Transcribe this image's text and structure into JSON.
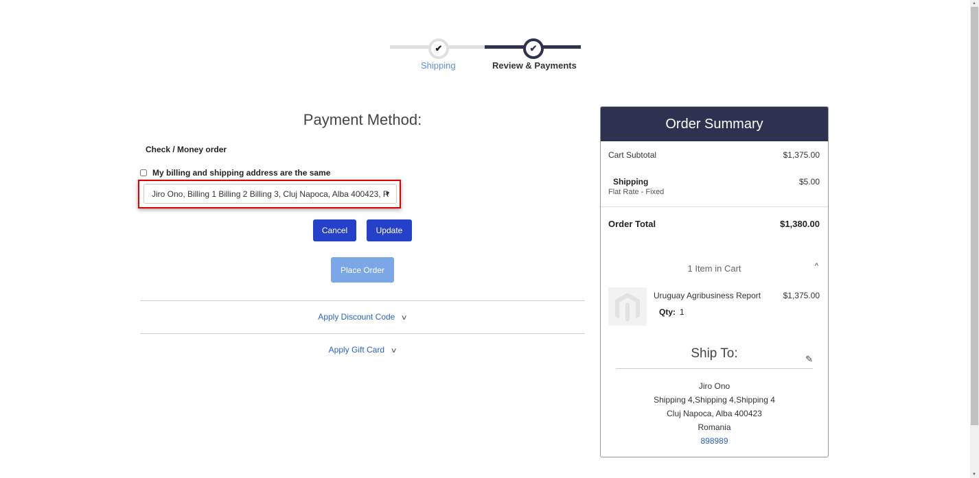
{
  "progress": {
    "steps": [
      {
        "label": "Shipping",
        "state": "completed"
      },
      {
        "label": "Review & Payments",
        "state": "active"
      }
    ],
    "check_glyph": "✔"
  },
  "payment": {
    "title": "Payment Method:",
    "method_name": "Check / Money order",
    "same_address_label": "My billing and shipping address are the same",
    "same_address_checked": false,
    "billing_address_selected": "Jiro Ono, Billing 1 Billing 2 Billing 3, Cluj Napoca, Alba 400423, R",
    "select_arrow": "▼",
    "cancel_label": "Cancel",
    "update_label": "Update",
    "place_order_label": "Place Order"
  },
  "discount": {
    "label": "Apply Discount Code",
    "chevron": "∨"
  },
  "gift_card": {
    "label": "Apply Gift Card",
    "chevron": "∨"
  },
  "summary": {
    "title": "Order Summary",
    "cart_subtotal_label": "Cart Subtotal",
    "cart_subtotal_value": "$1,375.00",
    "shipping_label": "Shipping",
    "shipping_method": "Flat Rate - Fixed",
    "shipping_value": "$5.00",
    "order_total_label": "Order Total",
    "order_total_value": "$1,380.00",
    "items_in_cart": "1 Item in Cart",
    "caret": "^",
    "items": [
      {
        "name": "Uruguay Agribusiness Report",
        "price": "$1,375.00",
        "qty_label": "Qty:",
        "qty": "1"
      }
    ]
  },
  "ship_to": {
    "title": "Ship To:",
    "edit_icon": "✎",
    "name": "Jiro Ono",
    "street": "Shipping 4,Shipping 4,Shipping 4",
    "city_line": "Cluj Napoca, Alba 400423",
    "country": "Romania",
    "phone": "898989"
  },
  "colors": {
    "primary_dark": "#2f3150",
    "button_blue": "#2541c9",
    "button_disabled": "#7ba7e6",
    "link_blue": "#2a62c9",
    "highlight_red": "#e00000"
  }
}
